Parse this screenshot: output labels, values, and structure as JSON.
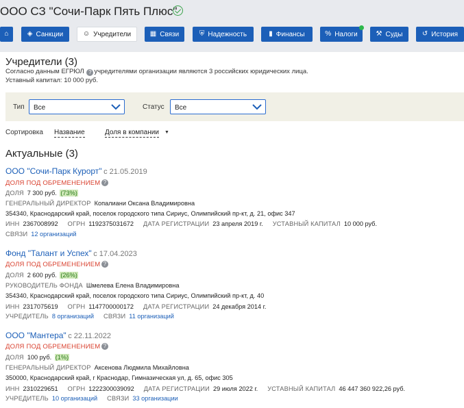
{
  "header": {
    "company_title": "ООО СЗ \"Сочи-Парк Пять Плюс\"",
    "verified_icon": "check-circle-icon"
  },
  "tabs": [
    {
      "label": "",
      "icon": "home-icon",
      "active": false
    },
    {
      "label": "Санкции",
      "icon": "globe-icon",
      "active": false
    },
    {
      "label": "Учредители",
      "icon": "users-icon",
      "active": true
    },
    {
      "label": "Связи",
      "icon": "network-icon",
      "active": false
    },
    {
      "label": "Надежность",
      "icon": "shield-icon",
      "active": false
    },
    {
      "label": "Финансы",
      "icon": "chart-icon",
      "active": false
    },
    {
      "label": "Налоги",
      "icon": "percent-icon",
      "active": false,
      "has_notification": true
    },
    {
      "label": "Суды",
      "icon": "gavel-icon",
      "active": false
    },
    {
      "label": "История",
      "icon": "history-icon",
      "active": false
    }
  ],
  "founders": {
    "title": "Учредители (3)",
    "desc_prefix": "Согласно данным ЕГРЮЛ",
    "desc_suffix": "учредителями организации являются 3 российских юридических лица.",
    "capital": "Уставный капитал: 10 000 руб."
  },
  "filters": {
    "type_label": "Тип",
    "type_value": "Все",
    "status_label": "Статус",
    "status_value": "Все"
  },
  "sort": {
    "label": "Сортировка",
    "by_name": "Название",
    "by_share": "Доля в компании",
    "arrow": "▼"
  },
  "actual_title": "Актуальные (3)",
  "common": {
    "pledge": "ДОЛЯ ПОД ОБРЕМЕНЕНИЕМ",
    "share": "ДОЛЯ",
    "inn": "ИНН",
    "ogrn": "ОГРН",
    "reg_date": "ДАТА РЕГИСТРАЦИИ",
    "capital": "УСТАВНЫЙ КАПИТАЛ",
    "links": "СВЯЗИ",
    "founder": "УЧРЕДИТЕЛЬ"
  },
  "orgs": [
    {
      "name": "ООО \"Сочи-Парк Курорт\"",
      "since": "с 21.05.2019",
      "share_value": "7 300 руб.",
      "share_pct": "(73%)",
      "head_role": "ГЕНЕРАЛЬНЫЙ ДИРЕКТОР",
      "head_name": "Копалиани Оксана Владимировна",
      "address": "354340, Краснодарский край, поселок городского типа Сириус, Олимпийский пр-кт, д. 21, офис 347",
      "inn": "2367008992",
      "ogrn": "1192375031672",
      "reg_date": "23 апреля 2019 г.",
      "capital": "10 000 руб.",
      "links": "12 организаций"
    },
    {
      "name": "Фонд \"Талант и Успех\"",
      "since": "с 17.04.2023",
      "share_value": "2 600 руб.",
      "share_pct": "(26%)",
      "head_role": "РУКОВОДИТЕЛЬ ФОНДА",
      "head_name": "Шмелева Елена Владимировна",
      "address": "354340, Краснодарский край, поселок городского типа Сириус, Олимпийский пр-кт, д. 40",
      "inn": "2317075619",
      "ogrn": "1147700000172",
      "reg_date": "24 декабря 2014 г.",
      "founder_links": "8 организаций",
      "links": "11 организаций"
    },
    {
      "name": "ООО \"Мантера\"",
      "since": "с 22.11.2022",
      "share_value": "100 руб.",
      "share_pct": "(1%)",
      "head_role": "ГЕНЕРАЛЬНЫЙ ДИРЕКТОР",
      "head_name": "Аксенова Людмила Михайловна",
      "address": "350000, Краснодарский край, г Краснодар, Гимназическая ул, д. 65, офис 305",
      "inn": "2310229651",
      "ogrn": "1222300039092",
      "reg_date": "29 июля 2022 г.",
      "capital": "46 447 360 922,26 руб.",
      "founder_links": "10 организаций",
      "links": "33 организации"
    }
  ]
}
